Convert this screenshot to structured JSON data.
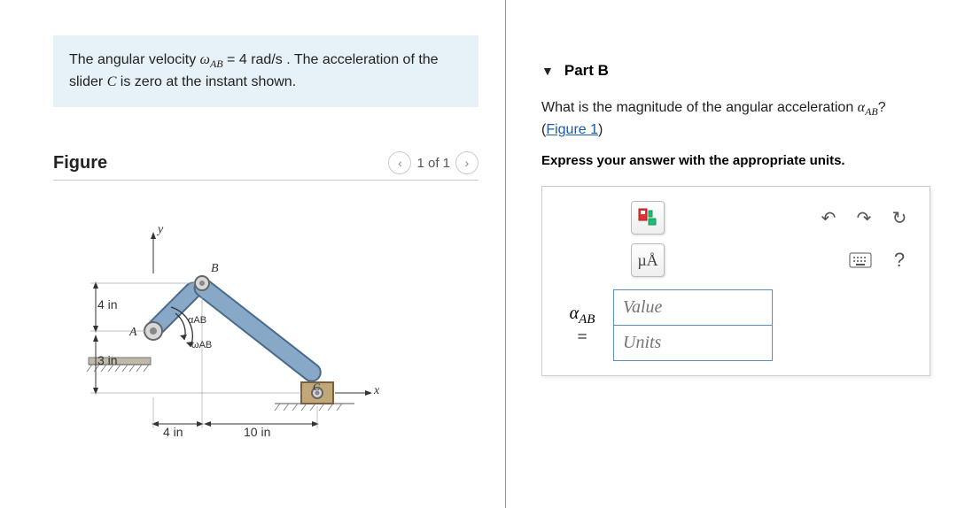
{
  "problem": {
    "prefix": "The angular velocity ",
    "var1_sym": "ω",
    "var1_sub": "AB",
    "mid1": " = 4 ",
    "units1": "rad/s",
    "mid2": " . The acceleration of the slider ",
    "var2": "C",
    "suffix": " is zero at the instant shown."
  },
  "figure": {
    "title": "Figure",
    "pager": "1 of 1",
    "dims": {
      "h1": "4 in",
      "h2": "3 in",
      "w1": "4 in",
      "w2": "10 in"
    },
    "labels": {
      "y": "y",
      "x": "x",
      "A": "A",
      "B": "B",
      "C": "C",
      "alpha": "αAB",
      "omega": "ωAB"
    }
  },
  "partB": {
    "title": "Part B",
    "question_prefix": "What is the magnitude of the angular acceleration ",
    "question_var_sym": "α",
    "question_var_sub": "AB",
    "question_suffix": "?",
    "fig_link": "Figure 1",
    "instruction": "Express your answer with the appropriate units.",
    "var_label_sym": "α",
    "var_label_sub": "AB",
    "equals": "=",
    "value_ph": "Value",
    "units_ph": "Units",
    "units_btn": "µÅ",
    "help": "?"
  }
}
